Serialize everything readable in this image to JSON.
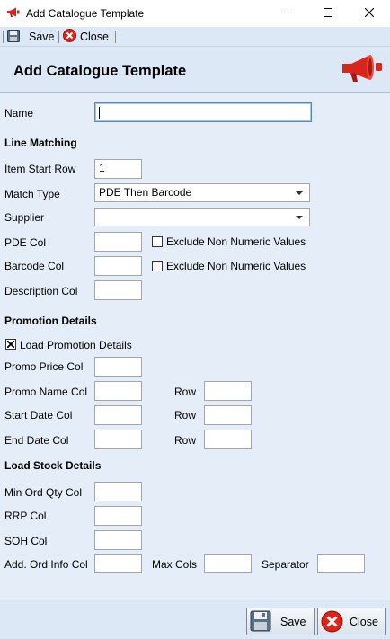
{
  "window": {
    "title": "Add Catalogue Template"
  },
  "toolbar": {
    "save_label": "Save",
    "close_label": "Close"
  },
  "header": {
    "title": "Add Catalogue Template"
  },
  "fields": {
    "name_label": "Name",
    "name_value": "",
    "line_matching_heading": "Line Matching",
    "item_start_row_label": "Item Start Row",
    "item_start_row_value": "1",
    "match_type_label": "Match Type",
    "match_type_value": "PDE Then Barcode",
    "supplier_label": "Supplier",
    "supplier_value": "",
    "pde_col_label": "PDE Col",
    "pde_exclude_label": "Exclude Non Numeric Values",
    "barcode_col_label": "Barcode Col",
    "barcode_exclude_label": "Exclude Non Numeric Values",
    "description_col_label": "Description Col",
    "promotion_heading": "Promotion Details",
    "load_promotion_label": "Load Promotion Details",
    "load_promotion_checked": true,
    "promo_price_col_label": "Promo Price Col",
    "promo_name_col_label": "Promo Name Col",
    "start_date_col_label": "Start Date Col",
    "end_date_col_label": "End Date Col",
    "row_label": "Row",
    "stock_heading": "Load Stock Details",
    "min_ord_qty_col_label": "Min Ord Qty Col",
    "rrp_col_label": "RRP Col",
    "soh_col_label": "SOH Col",
    "add_ord_info_col_label": "Add. Ord Info Col",
    "max_cols_label": "Max Cols",
    "separator_label": "Separator"
  },
  "footer": {
    "save_label": "Save",
    "close_label": "Close"
  },
  "icons": {
    "app": "megaphone-icon",
    "save": "floppy-disk-icon",
    "close": "red-x-circle-icon",
    "header": "megaphone-icon"
  },
  "colors": {
    "accent_red": "#d9261c",
    "panel": "#e4edf8",
    "header_bg": "#dce8f5"
  }
}
